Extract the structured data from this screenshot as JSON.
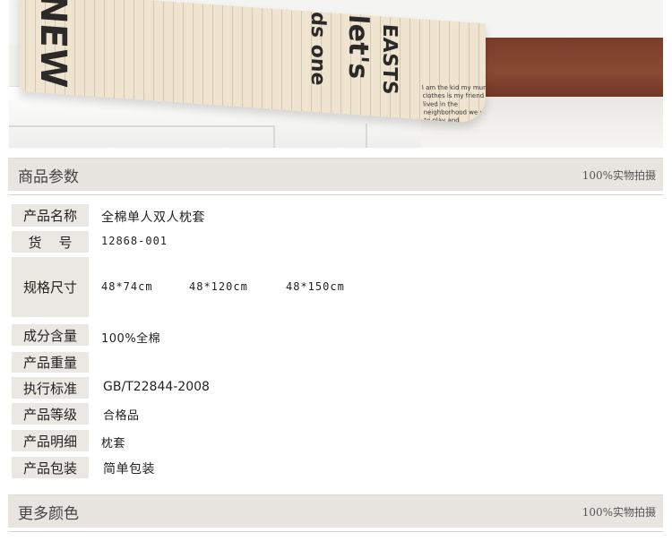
{
  "photo": {
    "print_big_1": "NEW",
    "print_big_2": "let's",
    "print_big_3": "ds one",
    "print_big_4": "EASTS",
    "print_small": "I am the kid my mum clothes is my friend lived in the neighborhood we used to play and"
  },
  "section_params": {
    "title": "商品参数",
    "tag": "100%实物拍摄"
  },
  "specs": [
    {
      "label": "产品名称",
      "value": "全棉单人双人枕套"
    },
    {
      "label": "货    号",
      "value": "12868-001"
    },
    {
      "label": "规格尺寸",
      "sizes": [
        "48*74cm",
        "48*120cm",
        "48*150cm"
      ]
    },
    {
      "label": "成分含量",
      "value": "100%全棉"
    },
    {
      "label": "产品重量",
      "value": ""
    },
    {
      "label": "执行标准",
      "value": "GB/T22844-2008"
    },
    {
      "label": "产品等级",
      "value": "合格品"
    },
    {
      "label": "产品明细",
      "value": "枕套"
    },
    {
      "label": "产品包装",
      "value": "简单包装"
    }
  ],
  "section_colors": {
    "title": "更多颜色",
    "tag": "100%实物拍摄"
  }
}
